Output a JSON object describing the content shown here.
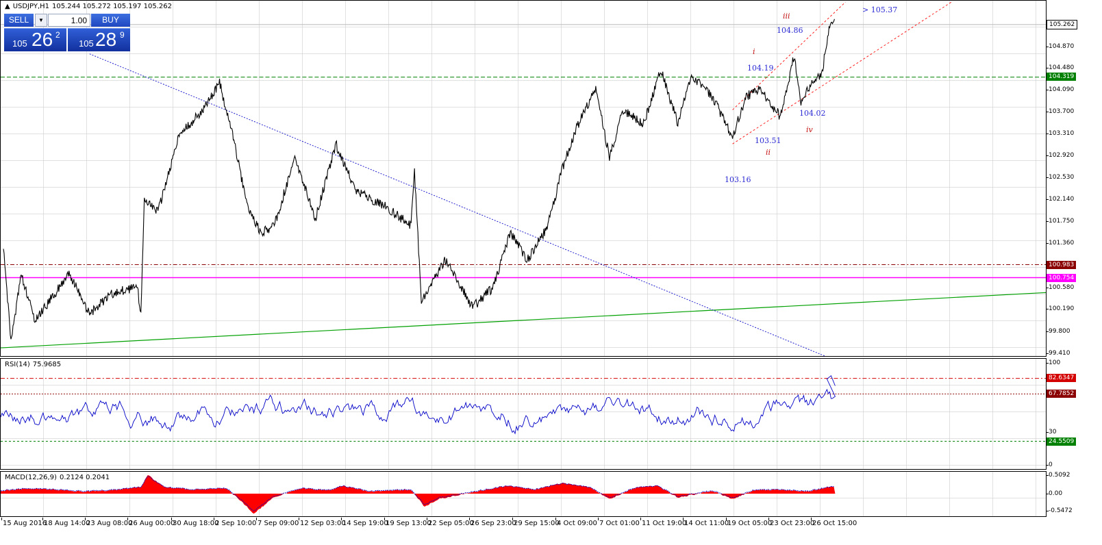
{
  "chart_header": {
    "symbol_timeframe": "USDJPY,H1",
    "ohlc": "105.244 105.272 105.197 105.262"
  },
  "trade_panel": {
    "sell_label": "SELL",
    "buy_label": "BUY",
    "volume": "1.00",
    "sell_price": {
      "prefix": "105",
      "big": "26",
      "sup": "2"
    },
    "buy_price": {
      "prefix": "105",
      "big": "28",
      "sup": "9"
    }
  },
  "price_axis": {
    "ticks": [
      "104.870",
      "104.480",
      "104.090",
      "103.700",
      "103.310",
      "102.920",
      "102.530",
      "102.140",
      "101.750",
      "101.360",
      "100.580",
      "100.190",
      "99.800",
      "99.410"
    ],
    "current_price": "105.262",
    "green_level": "104.319",
    "red_level": "100.983",
    "magenta_level": "100.754",
    "colors": {
      "current": "#ffffff",
      "green": "#008000",
      "red": "#8b0000",
      "magenta": "#ff00ff"
    }
  },
  "annotations": {
    "target": "> 105.37",
    "levels": [
      "104.86",
      "104.19",
      "104.02",
      "103.51",
      "103.16"
    ],
    "waves": [
      "iii",
      "i",
      "iv",
      "ii"
    ]
  },
  "rsi": {
    "title_name": "RSI(14)",
    "title_value": "75.9685",
    "scale": [
      "100",
      "30",
      "0"
    ],
    "level_high": "82.6347",
    "level_mid": "67.7852",
    "level_low": "24.5509",
    "colors": {
      "line": "#0000c8",
      "high": "#d40000",
      "mid": "#8b0000",
      "low": "#008000"
    }
  },
  "macd": {
    "title_name": "MACD(12,26,9)",
    "title_value": "0.2124 0.2041",
    "scale": [
      "0.5092",
      "0.00",
      "-0.5472"
    ],
    "colors": {
      "hist": "#ff0000",
      "signal": "#0000c8"
    }
  },
  "time_axis": [
    "15 Aug 2016",
    "18 Aug 14:00",
    "23 Aug 08:00",
    "26 Aug 00:00",
    "30 Aug 18:00",
    "2 Sep 10:00",
    "7 Sep 09:00",
    "12 Sep 03:00",
    "14 Sep 19:00",
    "19 Sep 13:00",
    "22 Sep 05:00",
    "26 Sep 23:00",
    "29 Sep 15:00",
    "4 Oct 09:00",
    "7 Oct 01:00",
    "11 Oct 19:00",
    "14 Oct 11:00",
    "19 Oct 05:00",
    "23 Oct 23:00",
    "26 Oct 15:00"
  ]
}
